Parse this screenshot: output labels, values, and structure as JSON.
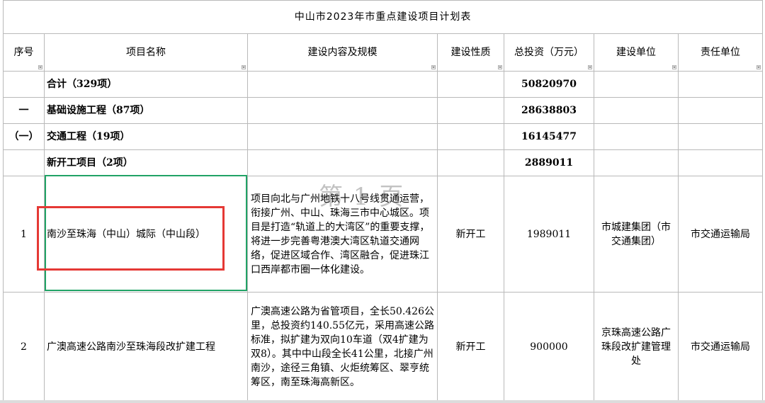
{
  "title": "中山市2023年市重点建设项目计划表",
  "headers": [
    "序号",
    "项目名称",
    "建设内容及规模",
    "建设性质",
    "总投资（万元）",
    "建设单位",
    "责任单位"
  ],
  "summary_rows": [
    {
      "no": "",
      "name": "合计（329项）",
      "investment": "50820970"
    },
    {
      "no": "一",
      "name": "基础设施工程（87项）",
      "investment": "28638803"
    },
    {
      "no": "（一）",
      "name": "交通工程（19项）",
      "investment": "16145477"
    },
    {
      "no": "",
      "name": "新开工项目（2项）",
      "investment": "2889011"
    }
  ],
  "projects": [
    {
      "no": "1",
      "name": "南沙至珠海（中山）城际（中山段）",
      "content": "项目向北与广州地铁十八号线贯通运营，衔接广州、中山、珠海三市中心城区。项目是打造“轨道上的大湾区”的重要支撑，将进一步完善粤港澳大湾区轨道交通网络，促进区域合作、湾区融合，促进珠江口西岸都市圈一体化建设。",
      "nature": "新开工",
      "investment": "1989011",
      "builder": "市城建集团（市交通集团）",
      "responsible": "市交通运输局"
    },
    {
      "no": "2",
      "name": "广澳高速公路南沙至珠海段改扩建工程",
      "content": "广澳高速公路为省管项目，全长50.426公里，总投资约140.55亿元，采用高速公路标准，拟扩建为双向10车道（双4扩建为双8）。其中中山段全长41公里，北接广州南沙，途径三角镇、火炬统筹区、翠亨统筹区，南至珠海高新区。",
      "nature": "新开工",
      "investment": "900000",
      "builder": "京珠高速公路广珠段改扩建管理处",
      "responsible": "市交通运输局"
    }
  ],
  "watermark": "第 1 页",
  "colors": {
    "selection": "#21a366",
    "highlight": "#e53935",
    "grid": "#b9b9b9"
  }
}
